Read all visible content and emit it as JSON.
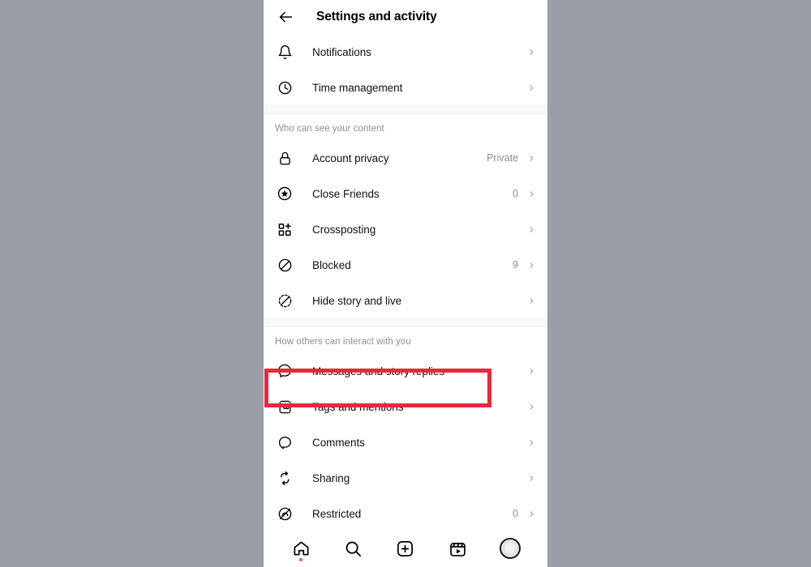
{
  "header": {
    "title": "Settings and activity",
    "back_icon": "arrow-left-icon"
  },
  "sections": [
    {
      "title": "",
      "rows": [
        {
          "label": "Notifications",
          "value": "",
          "icon": "bell-icon"
        },
        {
          "label": "Time management",
          "value": "",
          "icon": "clock-icon"
        }
      ]
    },
    {
      "title": "Who can see your content",
      "rows": [
        {
          "label": "Account privacy",
          "value": "Private",
          "icon": "lock-icon"
        },
        {
          "label": "Close Friends",
          "value": "0",
          "icon": "star-circle-icon"
        },
        {
          "label": "Crossposting",
          "value": "",
          "icon": "grid-plus-icon"
        },
        {
          "label": "Blocked",
          "value": "9",
          "icon": "block-icon"
        },
        {
          "label": "Hide story and live",
          "value": "",
          "icon": "hide-story-icon"
        }
      ]
    },
    {
      "title": "How others can interact with you",
      "rows": [
        {
          "label": "Messages and story replies",
          "value": "",
          "icon": "messenger-icon",
          "highlighted": true
        },
        {
          "label": "Tags and mentions",
          "value": "",
          "icon": "at-mention-icon"
        },
        {
          "label": "Comments",
          "value": "",
          "icon": "comment-icon"
        },
        {
          "label": "Sharing",
          "value": "",
          "icon": "share-refresh-icon"
        },
        {
          "label": "Restricted",
          "value": "0",
          "icon": "restricted-icon"
        }
      ]
    }
  ],
  "navbar": {
    "items": [
      {
        "icon": "home-icon",
        "badge": true
      },
      {
        "icon": "search-icon",
        "badge": false
      },
      {
        "icon": "create-plus-icon",
        "badge": false
      },
      {
        "icon": "reels-icon",
        "badge": false
      },
      {
        "icon": "profile-avatar-icon",
        "badge": false
      }
    ]
  },
  "colors": {
    "highlight": "#e8283c",
    "page_background": "#9b9ea6",
    "panel": "#ffffff",
    "muted_text": "#8e8e93"
  }
}
